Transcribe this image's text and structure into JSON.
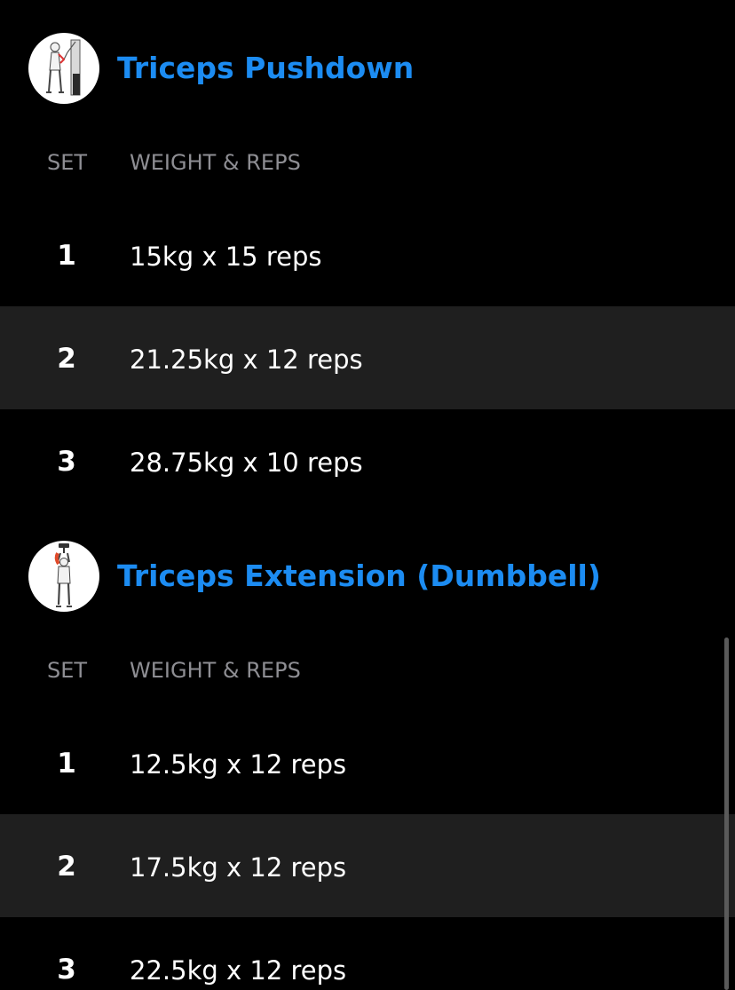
{
  "exercises": [
    {
      "title": "Triceps Pushdown",
      "thumb_icon": "cable-pushdown-illustration",
      "columns": {
        "set": "SET",
        "weight_reps": "WEIGHT & REPS"
      },
      "sets": [
        {
          "number": "1",
          "value": "15kg x 15 reps"
        },
        {
          "number": "2",
          "value": "21.25kg x 12 reps"
        },
        {
          "number": "3",
          "value": "28.75kg x 10 reps"
        }
      ]
    },
    {
      "title": "Triceps Extension (Dumbbell)",
      "thumb_icon": "dumbbell-overhead-extension-illustration",
      "columns": {
        "set": "SET",
        "weight_reps": "WEIGHT & REPS"
      },
      "sets": [
        {
          "number": "1",
          "value": "12.5kg x 12 reps"
        },
        {
          "number": "2",
          "value": "17.5kg x 12 reps"
        },
        {
          "number": "3",
          "value": "22.5kg x 12 reps"
        }
      ]
    }
  ],
  "colors": {
    "background": "#000000",
    "title_accent": "#1c8cf2",
    "row_alt_background": "#1f1f1f",
    "column_header": "#8e8e93"
  }
}
